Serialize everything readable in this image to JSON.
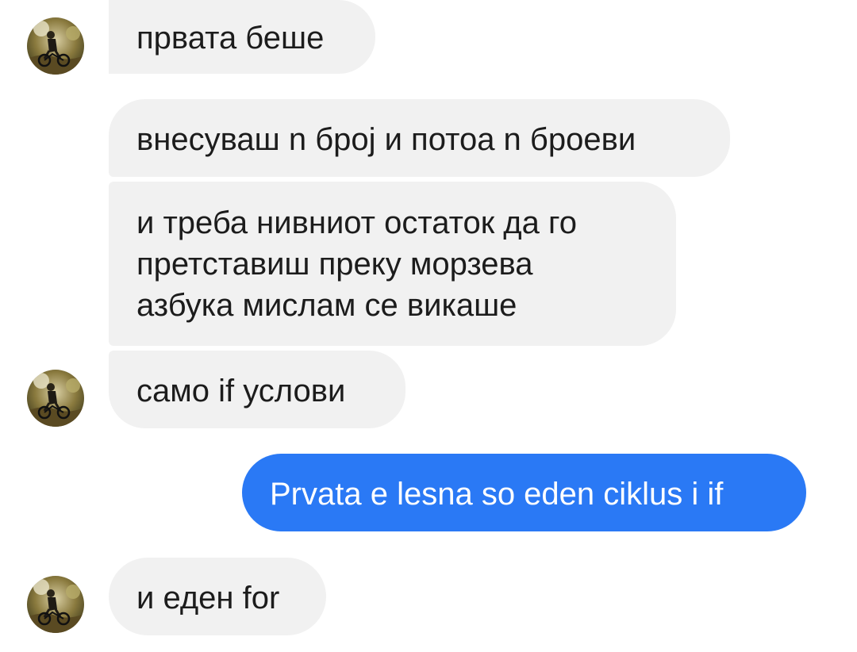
{
  "contact": {
    "avatar_icon": "contact-avatar-photo"
  },
  "messages": [
    {
      "sender": "contact",
      "text": "првата беше",
      "show_avatar": true
    },
    {
      "sender": "contact",
      "text": "внесуваш n број и потоа n броеви",
      "show_avatar": false
    },
    {
      "sender": "contact",
      "lines": [
        "и треба нивниот остаток да го",
        "претставиш преку морзева",
        "азбука мислам се викаше"
      ],
      "show_avatar": false
    },
    {
      "sender": "contact",
      "text": "само if услови",
      "show_avatar": true
    },
    {
      "sender": "me",
      "text": "Prvata e lesna so eden ciklus i if",
      "show_avatar": false
    },
    {
      "sender": "contact",
      "text": "и еден for",
      "show_avatar": true
    }
  ],
  "colors": {
    "incoming_bubble": "#f1f1f1",
    "outgoing_bubble": "#2a79f5",
    "incoming_text": "#1c1c1c",
    "outgoing_text": "#ffffff"
  }
}
